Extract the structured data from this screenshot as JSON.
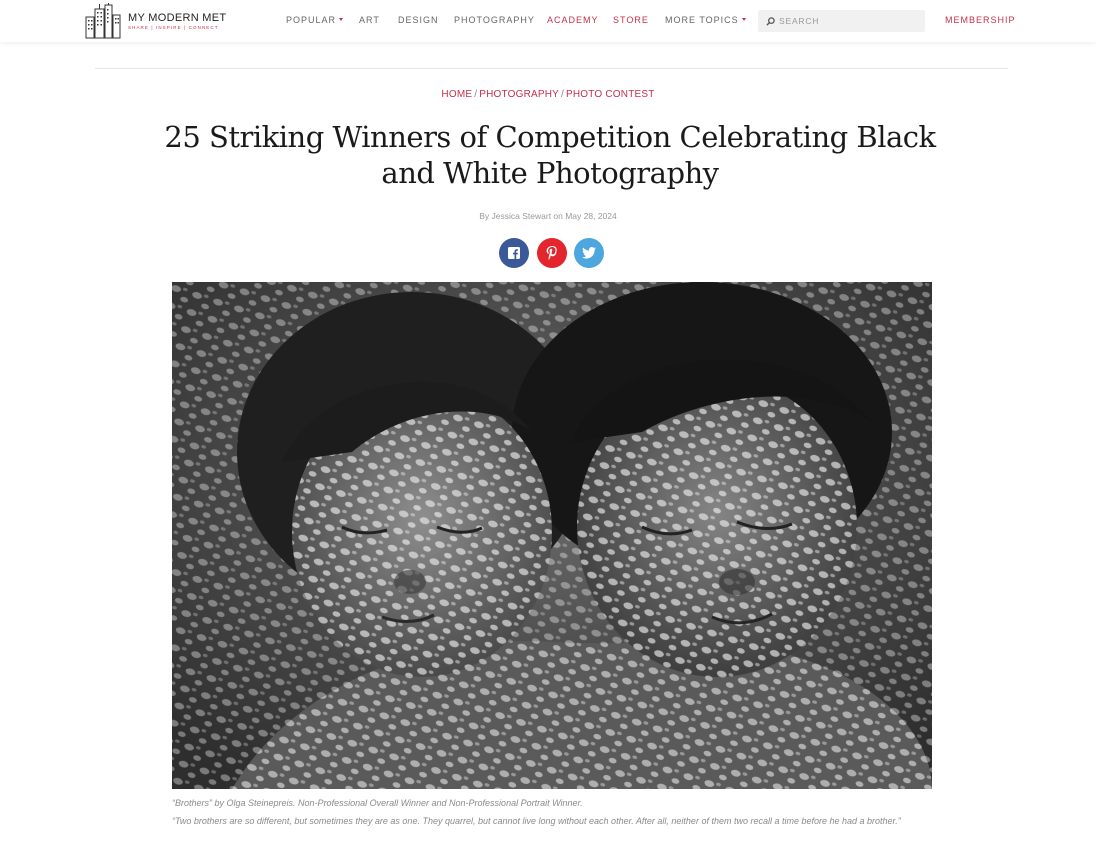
{
  "header": {
    "logo": {
      "name": "MY MODERN MET",
      "tagline": "SHARE | INSPIRE | CONNECT"
    },
    "nav": [
      {
        "label": "POPULAR",
        "dropdown": true,
        "accent": false
      },
      {
        "label": "ART",
        "dropdown": false,
        "accent": false
      },
      {
        "label": "DESIGN",
        "dropdown": false,
        "accent": false
      },
      {
        "label": "PHOTOGRAPHY",
        "dropdown": false,
        "accent": false
      },
      {
        "label": "ACADEMY",
        "dropdown": false,
        "accent": true
      },
      {
        "label": "STORE",
        "dropdown": false,
        "accent": true
      },
      {
        "label": "MORE TOPICS",
        "dropdown": true,
        "accent": false
      }
    ],
    "search": {
      "placeholder": "SEARCH",
      "value": ""
    },
    "membership": "MEMBERSHIP"
  },
  "breadcrumb": [
    {
      "label": "HOME"
    },
    {
      "label": "PHOTOGRAPHY"
    },
    {
      "label": "PHOTO CONTEST"
    }
  ],
  "breadcrumb_separator": "/",
  "article": {
    "title": "25 Striking Winners of Competition Celebrating Black and White Photography",
    "byline": "By Jessica Stewart on May 28, 2024",
    "share": [
      {
        "network": "facebook",
        "icon": "facebook-icon",
        "color": "#3b5998"
      },
      {
        "network": "pinterest",
        "icon": "pinterest-icon",
        "color": "#e3262d"
      },
      {
        "network": "twitter",
        "icon": "twitter-icon",
        "color": "#4da7de"
      }
    ],
    "photo": {
      "alt": "Black and white photo of two brothers with dappled light on their faces"
    },
    "caption_credit": "“Brothers” by Olga Steinepreis. Non-Professional Overall Winner and Non-Professional Portrait Winner.",
    "caption_quote": "“Two brothers are so different, but sometimes they are as one. They quarrel, but cannot live long without each other. After all, neither of them two recall a time before he had a brother.”"
  },
  "colors": {
    "accent": "#c4314b",
    "text": "#1a1a1a",
    "muted": "#999999"
  }
}
